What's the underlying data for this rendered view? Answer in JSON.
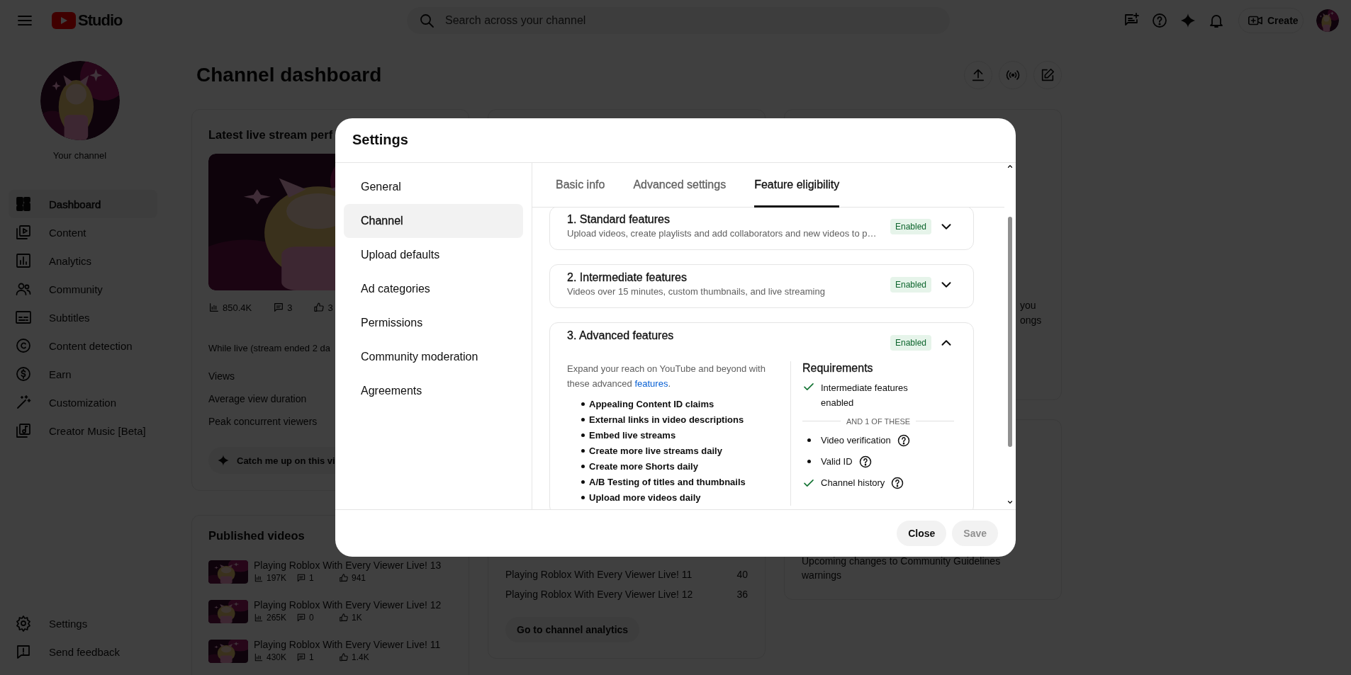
{
  "header": {
    "logo_text": "Studio",
    "search": {
      "placeholder": "Search across your channel"
    },
    "create_label": "Create"
  },
  "sidebar": {
    "channel_label": "Your channel",
    "items": [
      {
        "label": "Dashboard",
        "selected": true
      },
      {
        "label": "Content",
        "selected": false
      },
      {
        "label": "Analytics",
        "selected": false
      },
      {
        "label": "Community",
        "selected": false
      },
      {
        "label": "Subtitles",
        "selected": false
      },
      {
        "label": "Content detection",
        "selected": false
      },
      {
        "label": "Earn",
        "selected": false
      },
      {
        "label": "Customization",
        "selected": false
      },
      {
        "label": "Creator Music [Beta]",
        "selected": false
      }
    ],
    "footer_items": [
      {
        "label": "Settings"
      },
      {
        "label": "Send feedback"
      }
    ]
  },
  "page": {
    "title": "Channel dashboard"
  },
  "live_card": {
    "title": "Latest live stream perf",
    "stats": [
      "850.4K",
      "3",
      "3"
    ],
    "period": "While live (stream ended 2 da",
    "metrics": [
      "Views",
      "Average view duration",
      "Peak concurrent viewers"
    ],
    "catch_up": "Catch me up on this vi"
  },
  "published_card": {
    "title": "Published videos",
    "videos": [
      {
        "title": "Playing Roblox With Every Viewer Live! 13",
        "views": "197K",
        "comments": "1",
        "likes": "941"
      },
      {
        "title": "Playing Roblox With Every Viewer Live! 12",
        "views": "265K",
        "comments": "0",
        "likes": "1K"
      },
      {
        "title": "Playing Roblox With Every Viewer Live! 11",
        "views": "430K",
        "comments": "1",
        "likes": "1.4K"
      }
    ]
  },
  "analytics_card": {
    "rows": [
      {
        "title": "Playing Roblox With Every Viewer Live! 11",
        "value": "40"
      },
      {
        "title": "Playing Roblox With Every Viewer Live! 12",
        "value": "36"
      }
    ],
    "button": "Go to channel analytics"
  },
  "news_card": {
    "fragments": [
      "you",
      "ongs"
    ]
  },
  "community_card": {
    "text": "Upcoming changes to Community Guidelines warnings"
  },
  "dialog": {
    "title": "Settings",
    "nav": [
      {
        "label": "General",
        "selected": false
      },
      {
        "label": "Channel",
        "selected": true
      },
      {
        "label": "Upload defaults",
        "selected": false
      },
      {
        "label": "Ad categories",
        "selected": false
      },
      {
        "label": "Permissions",
        "selected": false
      },
      {
        "label": "Community moderation",
        "selected": false
      },
      {
        "label": "Agreements",
        "selected": false
      }
    ],
    "tabs": [
      {
        "label": "Basic info",
        "selected": false
      },
      {
        "label": "Advanced settings",
        "selected": false
      },
      {
        "label": "Feature eligibility",
        "selected": true
      }
    ],
    "features": [
      {
        "title": "1. Standard features",
        "description": "Upload videos, create playlists and add collaborators and new videos to p…",
        "status": "Enabled",
        "expanded": false
      },
      {
        "title": "2. Intermediate features",
        "description": "Videos over 15 minutes, custom thumbnails, and live streaming",
        "status": "Enabled",
        "expanded": false
      },
      {
        "title": "3. Advanced features",
        "status": "Enabled",
        "expanded": true,
        "details": {
          "intro": "Expand your reach on YouTube and beyond with these advanced",
          "link": "features",
          "intro_end": ".",
          "benefits": [
            "Appealing Content ID claims",
            "External links in video descriptions",
            "Embed live streams",
            "Create more live streams daily",
            "Create more Shorts daily",
            "A/B Testing of titles and thumbnails",
            "Upload more videos daily"
          ],
          "requirements": {
            "title": "Requirements",
            "required": [
              {
                "label": "Intermediate features enabled",
                "met": true
              }
            ],
            "divider": "AND 1 OF THESE",
            "options": [
              {
                "label": "Video verification",
                "met": false,
                "help": true
              },
              {
                "label": "Valid ID",
                "met": false,
                "help": true
              },
              {
                "label": "Channel history",
                "met": true,
                "help": true
              }
            ]
          }
        }
      }
    ],
    "buttons": [
      {
        "label": "Close",
        "disabled": false
      },
      {
        "label": "Save",
        "disabled": true
      }
    ]
  }
}
